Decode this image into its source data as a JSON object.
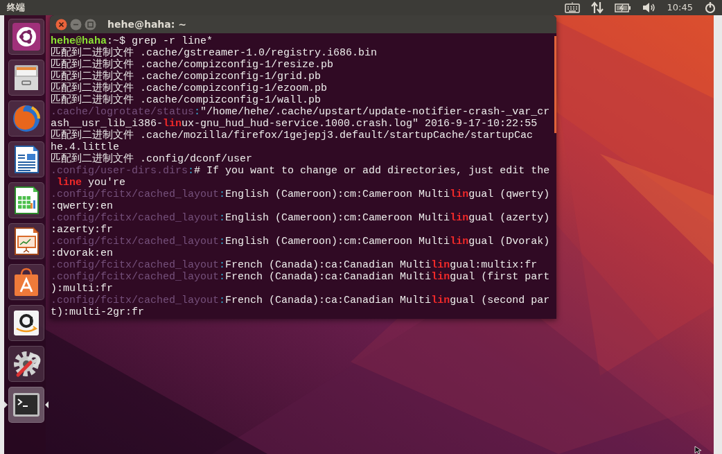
{
  "top_panel": {
    "app_title": "终端",
    "clock": "10:45"
  },
  "launcher": {
    "items": [
      {
        "kind": "ubuntu",
        "active": false
      },
      {
        "kind": "files",
        "active": false
      },
      {
        "kind": "browser",
        "active": false
      },
      {
        "kind": "writer",
        "active": false
      },
      {
        "kind": "calc",
        "active": false
      },
      {
        "kind": "impress",
        "active": false
      },
      {
        "kind": "store",
        "active": false
      },
      {
        "kind": "shop",
        "active": false
      },
      {
        "kind": "settings",
        "active": false
      },
      {
        "kind": "terminal",
        "active": true
      }
    ]
  },
  "window": {
    "title": "hehe@haha: ~",
    "lines": [
      [
        {
          "kind": "user",
          "text": "hehe@haha"
        },
        {
          "kind": "plain",
          "text": ":~$ grep -r line*"
        }
      ],
      [
        {
          "kind": "plain",
          "text": "匹配到二进制文件 .cache/gstreamer-1.0/registry.i686.bin"
        }
      ],
      [
        {
          "kind": "plain",
          "text": "匹配到二进制文件 .cache/compizconfig-1/resize.pb"
        }
      ],
      [
        {
          "kind": "plain",
          "text": "匹配到二进制文件 .cache/compizconfig-1/grid.pb"
        }
      ],
      [
        {
          "kind": "plain",
          "text": "匹配到二进制文件 .cache/compizconfig-1/ezoom.pb"
        }
      ],
      [
        {
          "kind": "plain",
          "text": "匹配到二进制文件 .cache/compizconfig-1/wall.pb"
        }
      ],
      [
        {
          "kind": "file",
          "text": ".cache/logrotate/status"
        },
        {
          "kind": "sep",
          "text": ":"
        },
        {
          "kind": "plain",
          "text": "\"/home/hehe/.cache/upstart/update-notifier-crash-_var_cr"
        }
      ],
      [
        {
          "kind": "plain",
          "text": "ash__usr_lib_i386-"
        },
        {
          "kind": "match",
          "text": "lin"
        },
        {
          "kind": "plain",
          "text": "ux-gnu_hud_hud-service.1000.crash.log\" 2016-9-17-10:22:55"
        }
      ],
      [
        {
          "kind": "plain",
          "text": "匹配到二进制文件 .cache/mozilla/firefox/1gejepj3.default/startupCache/startupCac"
        }
      ],
      [
        {
          "kind": "plain",
          "text": "he.4.little"
        }
      ],
      [
        {
          "kind": "plain",
          "text": "匹配到二进制文件 .config/dconf/user"
        }
      ],
      [
        {
          "kind": "file",
          "text": ".config/user-dirs.dirs"
        },
        {
          "kind": "sep",
          "text": ":"
        },
        {
          "kind": "plain",
          "text": "# If you want to change or add directories, just edit the"
        }
      ],
      [
        {
          "kind": "match",
          "text": " line"
        },
        {
          "kind": "plain",
          "text": " you're"
        }
      ],
      [
        {
          "kind": "file",
          "text": ".config/fcitx/cached_layout"
        },
        {
          "kind": "sep",
          "text": ":"
        },
        {
          "kind": "plain",
          "text": "English (Cameroon):cm:Cameroon Multi"
        },
        {
          "kind": "match",
          "text": "lin"
        },
        {
          "kind": "plain",
          "text": "gual (qwerty)"
        }
      ],
      [
        {
          "kind": "plain",
          "text": ":qwerty:en"
        }
      ],
      [
        {
          "kind": "file",
          "text": ".config/fcitx/cached_layout"
        },
        {
          "kind": "sep",
          "text": ":"
        },
        {
          "kind": "plain",
          "text": "English (Cameroon):cm:Cameroon Multi"
        },
        {
          "kind": "match",
          "text": "lin"
        },
        {
          "kind": "plain",
          "text": "gual (azerty)"
        }
      ],
      [
        {
          "kind": "plain",
          "text": ":azerty:fr"
        }
      ],
      [
        {
          "kind": "file",
          "text": ".config/fcitx/cached_layout"
        },
        {
          "kind": "sep",
          "text": ":"
        },
        {
          "kind": "plain",
          "text": "English (Cameroon):cm:Cameroon Multi"
        },
        {
          "kind": "match",
          "text": "lin"
        },
        {
          "kind": "plain",
          "text": "gual (Dvorak)"
        }
      ],
      [
        {
          "kind": "plain",
          "text": ":dvorak:en"
        }
      ],
      [
        {
          "kind": "file",
          "text": ".config/fcitx/cached_layout"
        },
        {
          "kind": "sep",
          "text": ":"
        },
        {
          "kind": "plain",
          "text": "French (Canada):ca:Canadian Multi"
        },
        {
          "kind": "match",
          "text": "lin"
        },
        {
          "kind": "plain",
          "text": "gual:multix:fr"
        }
      ],
      [
        {
          "kind": "file",
          "text": ".config/fcitx/cached_layout"
        },
        {
          "kind": "sep",
          "text": ":"
        },
        {
          "kind": "plain",
          "text": "French (Canada):ca:Canadian Multi"
        },
        {
          "kind": "match",
          "text": "lin"
        },
        {
          "kind": "plain",
          "text": "gual (first part"
        }
      ],
      [
        {
          "kind": "plain",
          "text": "):multi:fr"
        }
      ],
      [
        {
          "kind": "file",
          "text": ".config/fcitx/cached_layout"
        },
        {
          "kind": "sep",
          "text": ":"
        },
        {
          "kind": "plain",
          "text": "French (Canada):ca:Canadian Multi"
        },
        {
          "kind": "match",
          "text": "lin"
        },
        {
          "kind": "plain",
          "text": "gual (second par"
        }
      ],
      [
        {
          "kind": "plain",
          "text": "t):multi-2gr:fr"
        }
      ]
    ]
  }
}
